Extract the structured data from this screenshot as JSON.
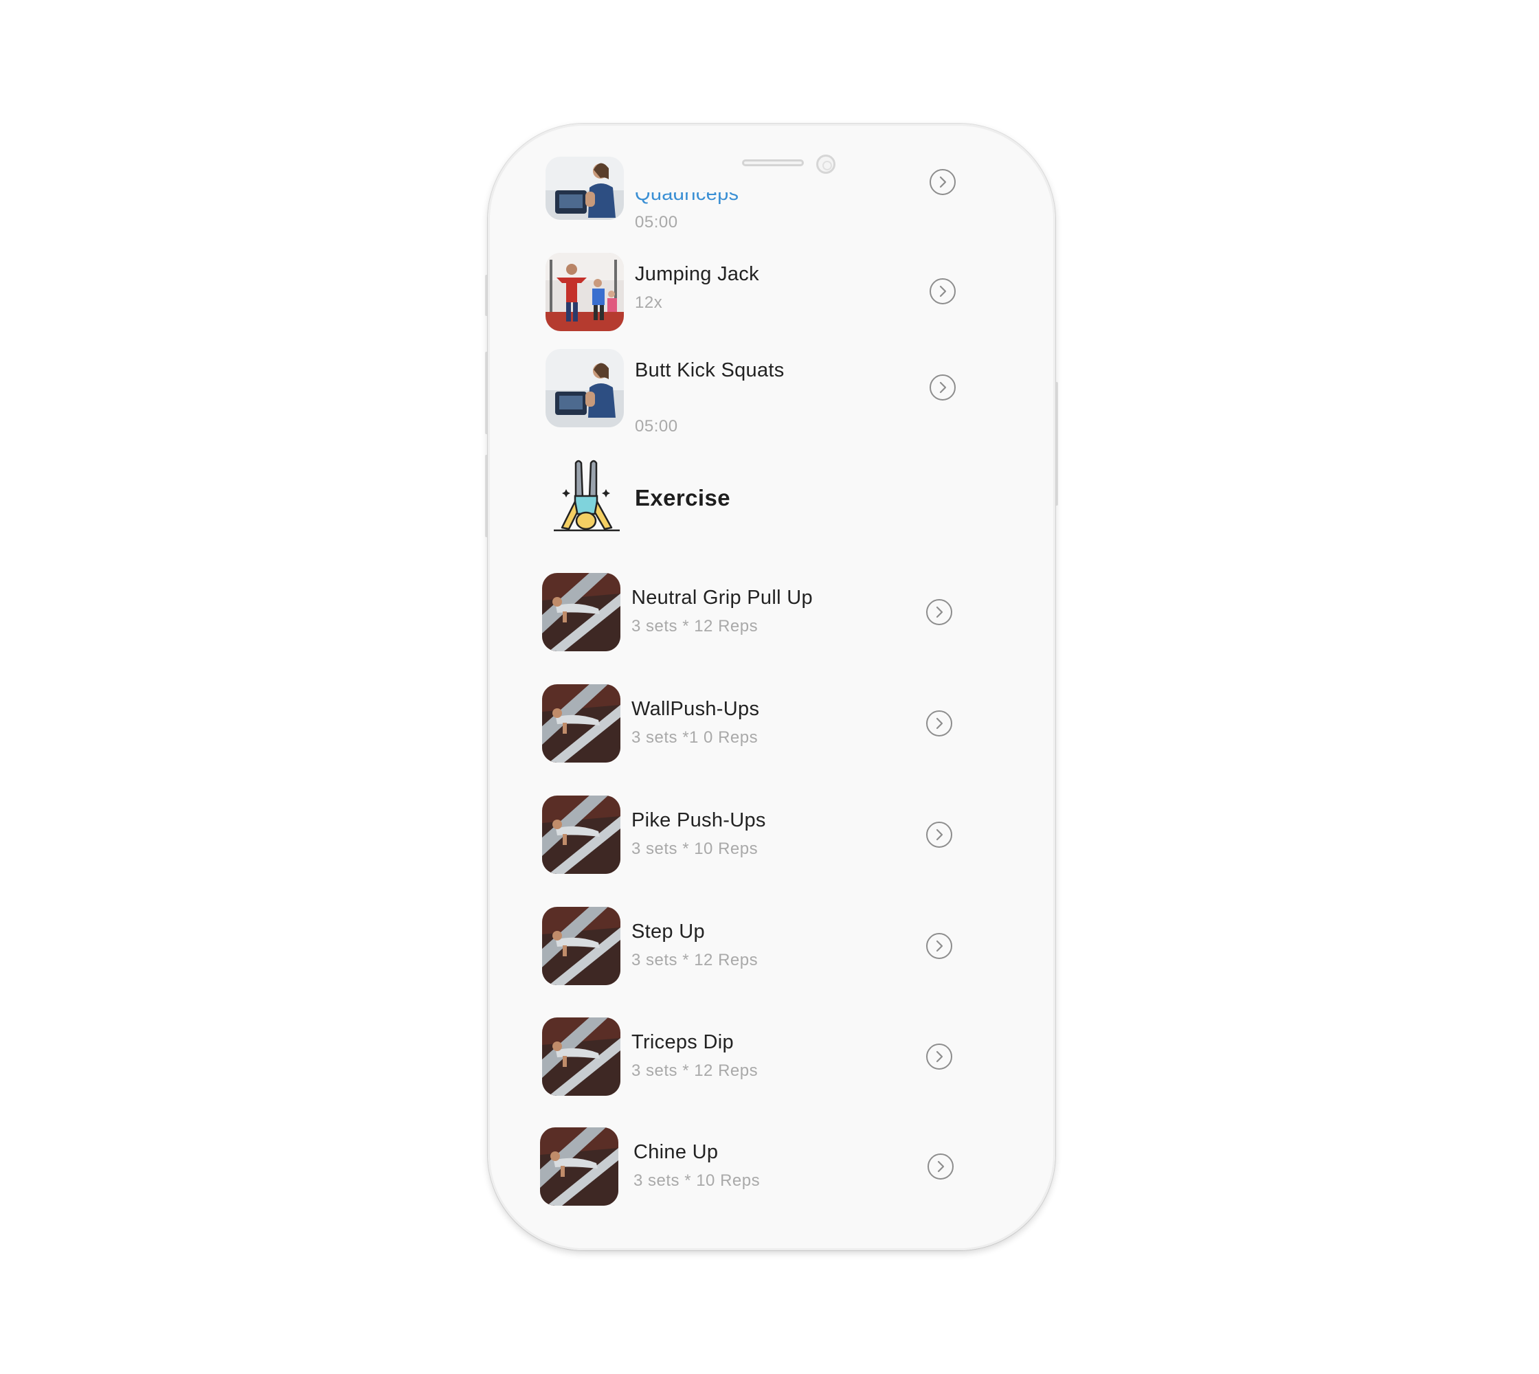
{
  "warmup": {
    "items": [
      {
        "title": "Quadriceps",
        "subtitle": "05:00",
        "thumb_icon": "treadmill-woman-image",
        "chevron_icon": "chevron-right-circle-icon"
      },
      {
        "title": "Jumping Jack",
        "subtitle": "12x",
        "thumb_icon": "gym-people-image",
        "chevron_icon": "chevron-right-circle-icon"
      },
      {
        "title": "Butt Kick Squats",
        "subtitle": "05:00",
        "thumb_icon": "treadmill-woman-image",
        "chevron_icon": "chevron-right-circle-icon"
      }
    ]
  },
  "exercise_section": {
    "title": "Exercise",
    "icon": "shoulder-stand-person-icon"
  },
  "exercises": [
    {
      "title": "Neutral Grip Pull Up",
      "subtitle": "3 sets * 12 Reps"
    },
    {
      "title": "WallPush-Ups",
      "subtitle": "3 sets *1 0 Reps"
    },
    {
      "title": "Pike Push-Ups",
      "subtitle": "3 sets * 10 Reps"
    },
    {
      "title": "Step Up",
      "subtitle": "3 sets * 12 Reps"
    },
    {
      "title": "Triceps Dip",
      "subtitle": "3 sets * 12 Reps"
    },
    {
      "title": "Chine Up",
      "subtitle": "3 sets * 10 Reps"
    }
  ],
  "colors": {
    "link_blue": "#3a8fd4",
    "title_dark": "#222222",
    "subtitle_gray": "#a9a9a9",
    "phone_bg": "#f9f9f9"
  }
}
